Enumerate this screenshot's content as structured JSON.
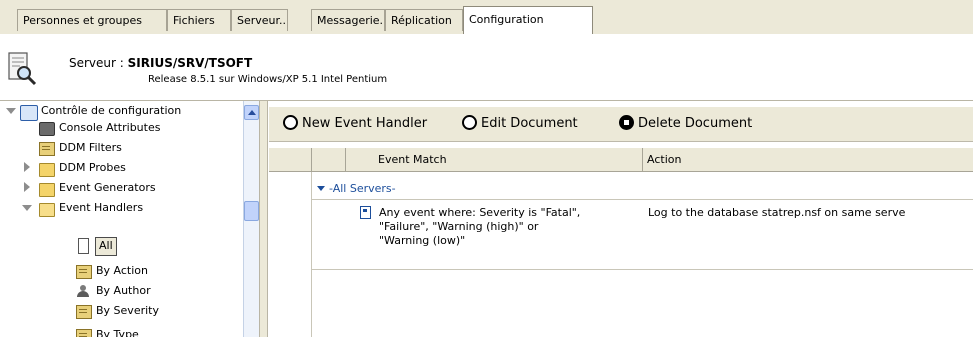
{
  "tabs": [
    {
      "label": "Personnes et groupes",
      "active": false
    },
    {
      "label": "Fichiers",
      "active": false
    },
    {
      "label": "Serveur...",
      "active": false
    },
    {
      "label": "Messagerie...",
      "active": false
    },
    {
      "label": "Réplication",
      "active": false
    },
    {
      "label": "Configuration",
      "active": true
    }
  ],
  "server": {
    "label_prefix": "Serveur : ",
    "name": "SIRIUS/SRV/TSOFT",
    "release": "Release 8.5.1 sur Windows/XP 5.1 Intel Pentium",
    "icon": "server-search-icon"
  },
  "tree": {
    "root": "Contrôle de configuration",
    "items": [
      {
        "label": "Console Attributes",
        "icon": "database-icon"
      },
      {
        "label": "DDM Filters",
        "icon": "view-icon"
      },
      {
        "label": "DDM Probes",
        "icon": "folder-icon"
      },
      {
        "label": "Event Generators",
        "icon": "folder-icon"
      },
      {
        "label": "Event Handlers",
        "icon": "folder-open-icon"
      },
      {
        "label": "All",
        "icon": "document-icon",
        "selected": true
      },
      {
        "label": "By Action",
        "icon": "view-icon"
      },
      {
        "label": "By Author",
        "icon": "person-icon"
      },
      {
        "label": "By Severity",
        "icon": "view-icon"
      },
      {
        "label": "By Type",
        "icon": "view-icon"
      }
    ]
  },
  "actions": {
    "new": "New Event Handler",
    "edit": "Edit Document",
    "delete": "Delete Document"
  },
  "columns": {
    "event_match": "Event Match",
    "action": "Action"
  },
  "category": "-All Servers-",
  "rows": [
    {
      "event_match_lines": [
        "Any event where: Severity is \"Fatal\",",
        "\"Failure\", \"Warning (high)\" or",
        "\"Warning (low)\""
      ],
      "action": "Log to the database statrep.nsf on same serve"
    }
  ]
}
